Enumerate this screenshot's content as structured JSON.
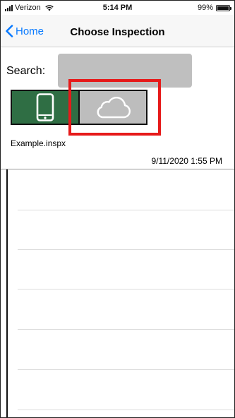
{
  "status_bar": {
    "carrier": "Verizon",
    "time": "5:14 PM",
    "battery": "99%",
    "battery_level": 0.99
  },
  "nav": {
    "back_label": "Home",
    "title": "Choose Inspection"
  },
  "search": {
    "label": "Search:",
    "value": "",
    "placeholder": ""
  },
  "tabs": {
    "device_icon": "phone-icon",
    "cloud_icon": "cloud-icon",
    "selected": "device"
  },
  "files": [
    {
      "name": "Example.inspx",
      "date": "9/11/2020 1:55 PM"
    }
  ],
  "colors": {
    "accent": "#0a7aff",
    "device_tab": "#2f6e44",
    "cloud_tab": "#bdbdbd",
    "highlight": "#e61a1a"
  }
}
